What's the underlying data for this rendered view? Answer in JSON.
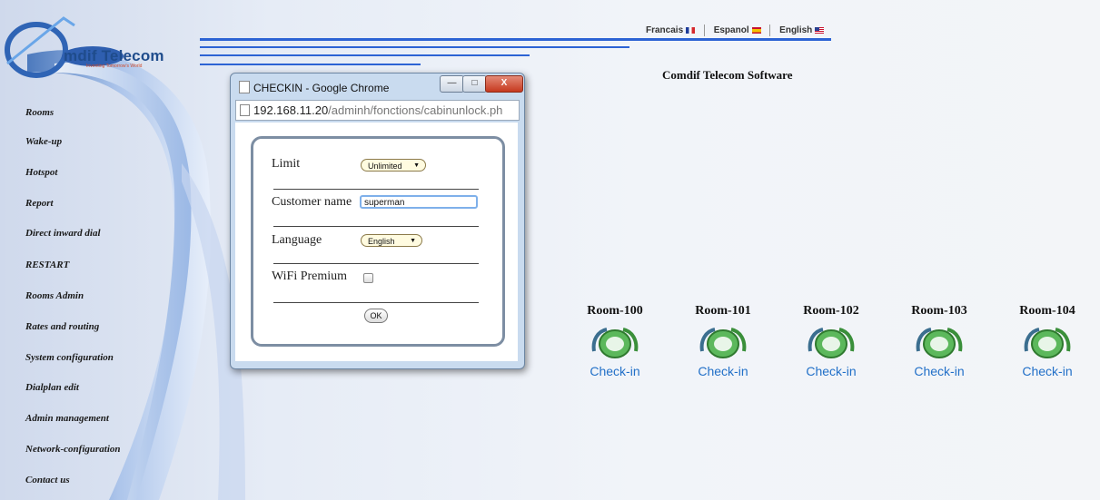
{
  "logo": {
    "name": "mdif Telecom",
    "tagline": "Inventing Tomorrow's World"
  },
  "languages": [
    {
      "label": "Francais",
      "flag": "france-flag-icon"
    },
    {
      "label": "Espanol",
      "flag": "spain-flag-icon"
    },
    {
      "label": "English",
      "flag": "usa-flag-icon"
    }
  ],
  "software_title": "Comdif Telecom Software",
  "menu": [
    "Rooms",
    "Wake-up",
    "Hotspot",
    "Report",
    "Direct inward dial",
    "RESTART",
    "Rooms Admin",
    "Rates and routing",
    "System configuration",
    "Dialplan edit",
    "Admin management",
    "Network-configuration",
    "Contact us"
  ],
  "rooms": [
    {
      "name": "Room-100",
      "action": "Check-in"
    },
    {
      "name": "Room-101",
      "action": "Check-in"
    },
    {
      "name": "Room-102",
      "action": "Check-in"
    },
    {
      "name": "Room-103",
      "action": "Check-in"
    },
    {
      "name": "Room-104",
      "action": "Check-in"
    }
  ],
  "popup": {
    "title": "CHECKIN - Google Chrome",
    "url_host": "192.168.11.20",
    "url_path": "/adminh/fonctions/cabinunlock.ph",
    "buttons": {
      "minimize": "—",
      "maximize": "□",
      "close": "X"
    },
    "form": {
      "limit_label": "Limit",
      "limit_value": "Unlimited",
      "customer_label": "Customer name",
      "customer_value": "superman",
      "language_label": "Language",
      "language_value": "English",
      "wifi_label": "WiFi Premium",
      "wifi_checked": false,
      "ok_label": "OK"
    }
  },
  "colors": {
    "accent_blue": "#2c63d4",
    "link_blue": "#2270c8",
    "room_icon_green": "#4aa84a"
  }
}
